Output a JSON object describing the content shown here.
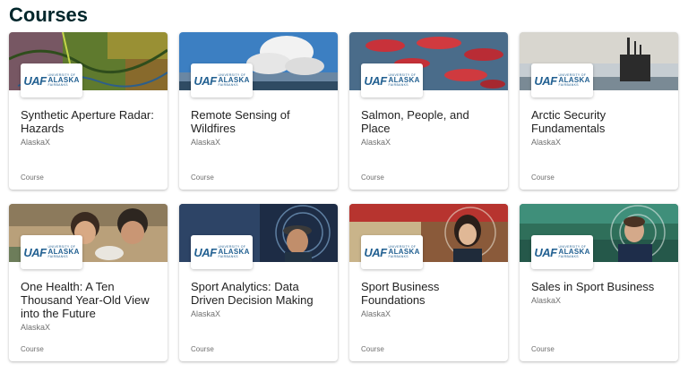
{
  "page": {
    "title": "Courses"
  },
  "logo": {
    "mark": "UAF",
    "line1": "UNIVERSITY OF",
    "line2": "ALASKA",
    "line3": "FAIRBANKS"
  },
  "courses": [
    {
      "title": "Synthetic Aperture Radar: Hazards",
      "org": "AlaskaX",
      "type": "Course"
    },
    {
      "title": "Remote Sensing of Wildfires",
      "org": "AlaskaX",
      "type": "Course"
    },
    {
      "title": "Salmon, People, and Place",
      "org": "AlaskaX",
      "type": "Course"
    },
    {
      "title": "Arctic Security Fundamentals",
      "org": "AlaskaX",
      "type": "Course"
    },
    {
      "title": "One Health: A Ten Thousand Year-Old View into the Future",
      "org": "AlaskaX",
      "type": "Course"
    },
    {
      "title": "Sport Analytics: Data Driven Decision Making",
      "org": "AlaskaX",
      "type": "Course"
    },
    {
      "title": "Sport Business Foundations",
      "org": "AlaskaX",
      "type": "Course"
    },
    {
      "title": "Sales in Sport Business",
      "org": "AlaskaX",
      "type": "Course"
    }
  ],
  "colors": {
    "brand_blue": "#236192",
    "title_color": "#00262b"
  }
}
